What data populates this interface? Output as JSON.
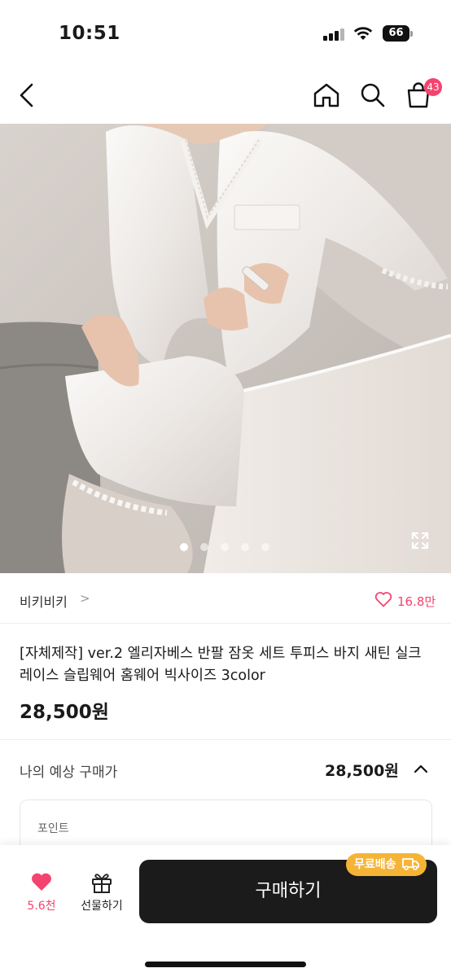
{
  "status_bar": {
    "time": "10:51",
    "battery": "66"
  },
  "nav": {
    "cart_badge": "43"
  },
  "gallery": {
    "image_count": 5,
    "active_index": 0
  },
  "brand": {
    "name": "비키비키",
    "chevron": ">",
    "like_count": "16.8만"
  },
  "product": {
    "title": "[자체제작] ver.2 엘리자베스 반팔 잠옷 세트 투피스 바지 새틴 실크 레이스 슬립웨어 홈웨어 빅사이즈 3color",
    "price": "28,500원"
  },
  "estimate": {
    "label": "나의 예상 구매가",
    "price": "28,500원"
  },
  "point": {
    "label": "포인트"
  },
  "bottom_bar": {
    "wish_count": "5.6천",
    "gift_label": "선물하기",
    "buy_label": "구매하기",
    "shipping_badge": "무료배송"
  },
  "colors": {
    "accent_pink": "#f5436f",
    "badge_orange": "#f6b436",
    "buy_button": "#1b1b1b"
  },
  "icons": [
    "back-icon",
    "home-icon",
    "search-icon",
    "cart-icon",
    "expand-icon",
    "heart-icon",
    "gift-icon",
    "truck-icon"
  ]
}
